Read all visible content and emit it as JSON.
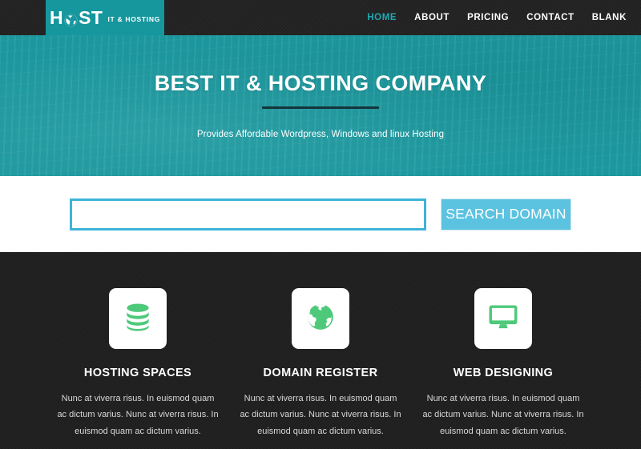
{
  "colors": {
    "header_bg": "#242424",
    "logo_bg": "#16969d",
    "hero_bg": "#1c9aa0",
    "accent_nav_active": "#22a7b0",
    "search_border": "#3cb4d9",
    "search_button_bg": "#5bc3e0",
    "features_bg": "#212121",
    "icon_green": "#4ec97a",
    "divider_dark": "#13343a"
  },
  "header": {
    "logo": {
      "text_before": "H",
      "globe_icon": "globe-icon",
      "text_after": "ST",
      "subtitle": "IT & HOSTING"
    },
    "nav": [
      {
        "label": "HOME",
        "active": true
      },
      {
        "label": "ABOUT",
        "active": false
      },
      {
        "label": "PRICING",
        "active": false
      },
      {
        "label": "CONTACT",
        "active": false
      },
      {
        "label": "BLANK",
        "active": false
      }
    ]
  },
  "hero": {
    "title": "BEST IT & HOSTING COMPANY",
    "subtitle": "Provides Affordable Wordpress, Windows and linux Hosting"
  },
  "search": {
    "value": "",
    "placeholder": "",
    "button_label": "SEARCH DOMAIN"
  },
  "features": [
    {
      "icon": "database-icon",
      "title": "HOSTING SPACES",
      "text": "Nunc at viverra risus. In euismod quam ac dictum varius. Nunc at viverra risus. In euismod quam ac dictum varius."
    },
    {
      "icon": "globe-icon",
      "title": "DOMAIN REGISTER",
      "text": "Nunc at viverra risus. In euismod quam ac dictum varius. Nunc at viverra risus. In euismod quam ac dictum varius."
    },
    {
      "icon": "desktop-monitor-icon",
      "title": "WEB DESIGNING",
      "text": "Nunc at viverra risus. In euismod quam ac dictum varius. Nunc at viverra risus. In euismod quam ac dictum varius."
    }
  ]
}
